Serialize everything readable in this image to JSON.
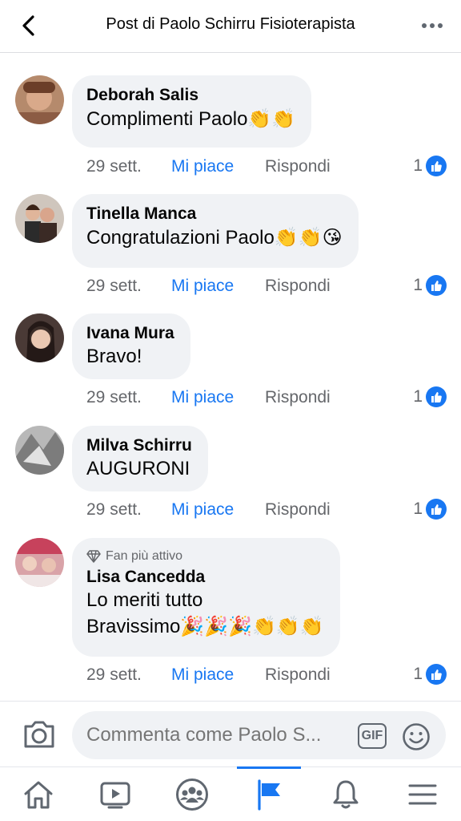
{
  "header": {
    "title": "Post di Paolo Schirru Fisioterapista",
    "back_icon": "chevron-left-icon",
    "more_icon": "more-horizontal-icon"
  },
  "comments": [
    {
      "author": "Deborah Salis",
      "text": "Complimenti Paolo",
      "emoji": "👏👏",
      "time": "29 sett.",
      "like_label": "Mi piace",
      "reply_label": "Rispondi",
      "reaction_count": "1"
    },
    {
      "author": "Tinella Manca",
      "text": "Congratulazioni Paolo",
      "emoji": "👏👏😘",
      "time": "29 sett.",
      "like_label": "Mi piace",
      "reply_label": "Rispondi",
      "reaction_count": "1"
    },
    {
      "author": "Ivana Mura",
      "text": "Bravo!",
      "time": "29 sett.",
      "like_label": "Mi piace",
      "reply_label": "Rispondi",
      "reaction_count": "1"
    },
    {
      "author": "Milva Schirru",
      "text": "AUGURONI",
      "time": "29 sett.",
      "like_label": "Mi piace",
      "reply_label": "Rispondi",
      "reaction_count": "1"
    },
    {
      "badge": "Fan più attivo",
      "author": "Lisa Cancedda",
      "text_line1": "Lo meriti tutto",
      "text_line2": "Bravissimo",
      "emoji": "🎉🎉🎉👏👏👏",
      "time": "29 sett.",
      "like_label": "Mi piace",
      "reply_label": "Rispondi",
      "reaction_count": "1"
    }
  ],
  "composer": {
    "placeholder": "Commenta come Paolo S...",
    "gif_label": "GIF"
  },
  "tabs": [
    {
      "icon": "home-icon",
      "active": false
    },
    {
      "icon": "video-icon",
      "active": false
    },
    {
      "icon": "groups-icon",
      "active": false
    },
    {
      "icon": "pages-flag-icon",
      "active": true
    },
    {
      "icon": "bell-icon",
      "active": false
    },
    {
      "icon": "menu-icon",
      "active": false
    }
  ],
  "colors": {
    "accent": "#1877f2",
    "bubble": "#f0f2f5",
    "secondary_text": "#65676b"
  }
}
